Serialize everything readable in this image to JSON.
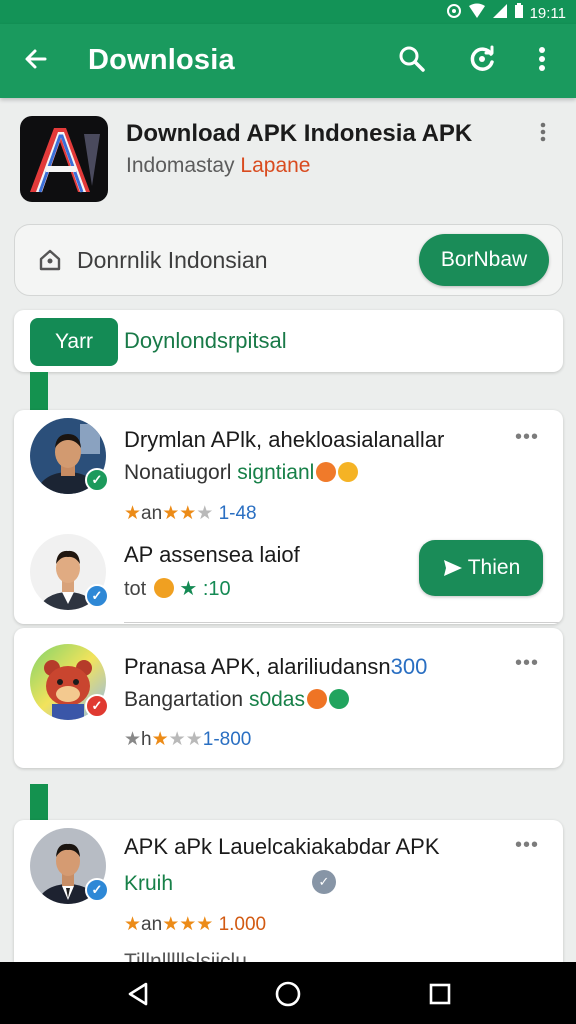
{
  "status_bar": {
    "time": "19:11"
  },
  "app_bar": {
    "title": "Downlosia",
    "icons": [
      "back-arrow-icon",
      "search-icon",
      "sync-icon",
      "more-vert-icon"
    ]
  },
  "app": {
    "name": "Download APK Indonesia APK",
    "subtitle_main": "Indomastay",
    "subtitle_accent": "Lapane",
    "logo_text": "A"
  },
  "search": {
    "text": "Donrnlik Indonsian",
    "button": "BorNbaw"
  },
  "tabs": {
    "chip": "Yarr",
    "text": "Doynlondsrpitsal"
  },
  "items": [
    {
      "title": "Drymlan APlk, ahekloasialanallar",
      "sub": "Nonatiugorl",
      "sub_green": "signtianl",
      "stars": "an",
      "count": "1-48"
    },
    {
      "title": "AP assensea laiof",
      "sub_stars": "tot",
      "count": ":10",
      "button": "Thien"
    },
    {
      "title": "Pranasa APK, alariliudansn",
      "title_num": "300",
      "sub": "Bangartation",
      "sub_green": "s0das",
      "stars": "h",
      "count": "1-800"
    },
    {
      "title": "APK aPk Lauelcakiakabdar APK",
      "sub_green": "Kruih",
      "stars": "an",
      "count": "1.000"
    }
  ],
  "peek": {
    "text": "Tillnlllllslsiiclu"
  },
  "colors": {
    "primary": "#1a9a5e",
    "accent": "#d94b1f",
    "star": "#ec8b17"
  }
}
